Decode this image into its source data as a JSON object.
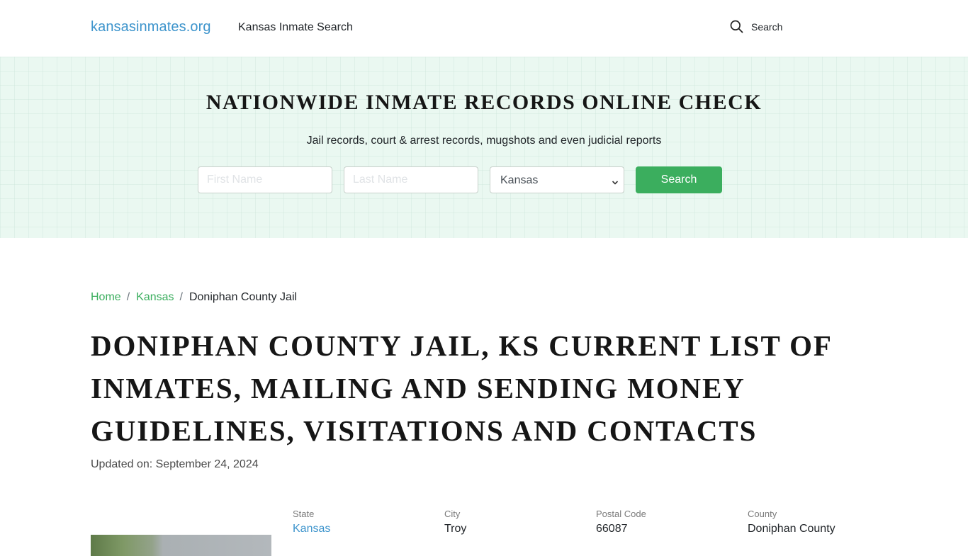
{
  "header": {
    "brand": "kansasinmates.org",
    "nav_link": "Kansas Inmate Search",
    "search_label": "Search",
    "search_icon": "search-icon"
  },
  "hero": {
    "title": "NATIONWIDE INMATE RECORDS ONLINE CHECK",
    "subtitle": "Jail records, court & arrest records, mugshots and even judicial reports",
    "first_name_placeholder": "First Name",
    "first_name_value": "",
    "last_name_placeholder": "Last Name",
    "last_name_value": "",
    "state_selected": "Kansas",
    "search_button": "Search"
  },
  "breadcrumb": {
    "items": [
      {
        "label": "Home"
      },
      {
        "label": "Kansas"
      },
      {
        "label": "Doniphan County Jail"
      }
    ],
    "separator": "/"
  },
  "page": {
    "title": "DONIPHAN COUNTY JAIL, KS CURRENT LIST OF INMATES, MAILING AND SENDING MONEY GUIDELINES, VISITATIONS AND CONTACTS",
    "updated": "Updated on: September 24, 2024"
  },
  "info": [
    {
      "label": "State",
      "value": "Kansas"
    },
    {
      "label": "City",
      "value": "Troy"
    },
    {
      "label": "Postal Code",
      "value": "66087"
    },
    {
      "label": "County",
      "value": "Doniphan County"
    }
  ],
  "colors": {
    "brand_blue": "#3d94cc",
    "accent_green": "#3bae5e",
    "hero_bg": "#eaf8f1"
  }
}
